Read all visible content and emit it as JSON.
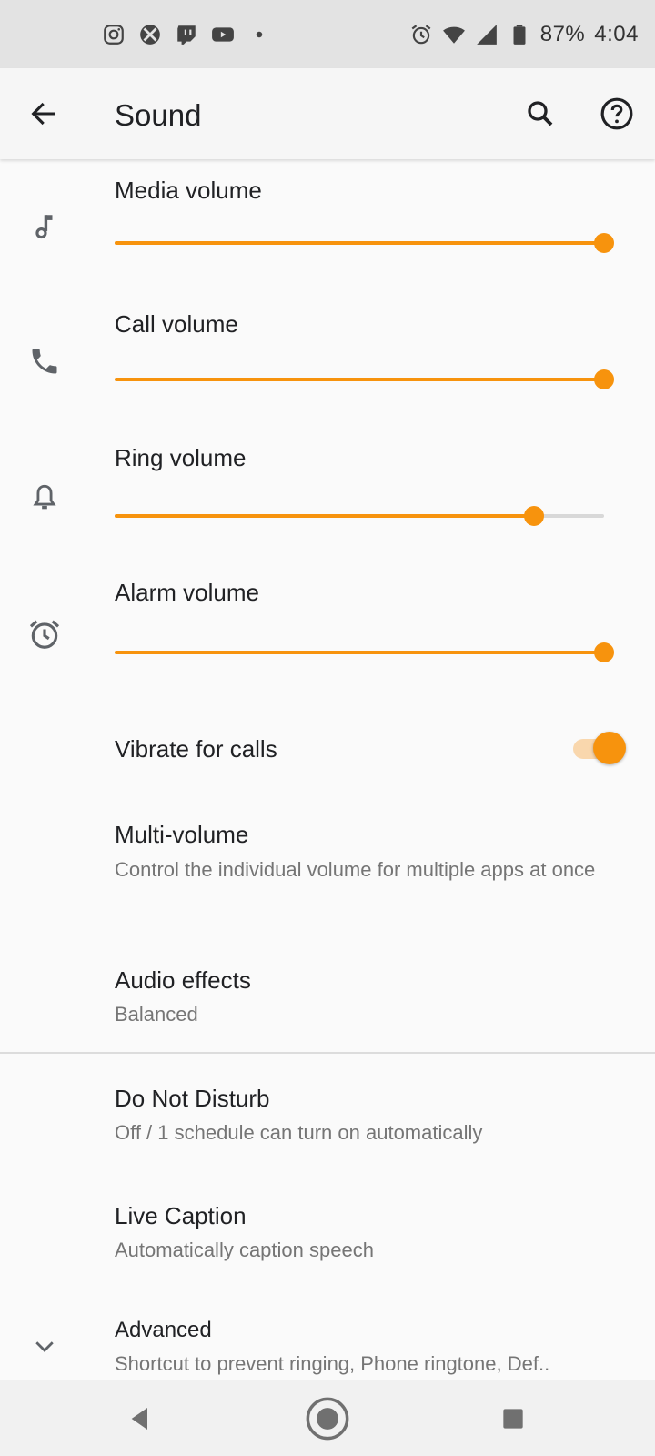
{
  "status_bar": {
    "notification_icons": [
      "instagram-icon",
      "xbox-icon",
      "twitch-icon",
      "youtube-icon",
      "dot-icon"
    ],
    "system_icons": [
      "alarm-icon",
      "wifi-icon",
      "signal-icon",
      "battery-icon"
    ],
    "battery": "87%",
    "time": "4:04"
  },
  "app_bar": {
    "title": "Sound",
    "back_icon": "arrow-back-icon",
    "search_icon": "search-icon",
    "help_icon": "help-icon"
  },
  "volumes": [
    {
      "label": "Media volume",
      "icon": "music-note-icon",
      "level": 1.0
    },
    {
      "label": "Call volume",
      "icon": "phone-icon",
      "level": 1.0
    },
    {
      "label": "Ring volume",
      "icon": "bell-icon",
      "level": 0.857
    },
    {
      "label": "Alarm volume",
      "icon": "alarm-clock-icon",
      "level": 1.0
    }
  ],
  "vibrate": {
    "label": "Vibrate for calls",
    "on": true
  },
  "multi_volume": {
    "title": "Multi-volume",
    "summary": "Control the individual volume for multiple apps at once"
  },
  "audio_effects": {
    "title": "Audio effects",
    "summary": "Balanced"
  },
  "dnd": {
    "title": "Do Not Disturb",
    "summary": "Off / 1 schedule can turn on automatically"
  },
  "live_caption": {
    "title": "Live Caption",
    "summary": "Automatically caption speech"
  },
  "advanced": {
    "title": "Advanced",
    "summary": "Shortcut to prevent ringing, Phone ringtone, Def..",
    "icon": "chevron-down-icon"
  },
  "colors": {
    "accent": "#f7930d",
    "accent_light": "#f9d7ad",
    "status_bar": "#e3e3e3",
    "background": "#fafafa"
  }
}
